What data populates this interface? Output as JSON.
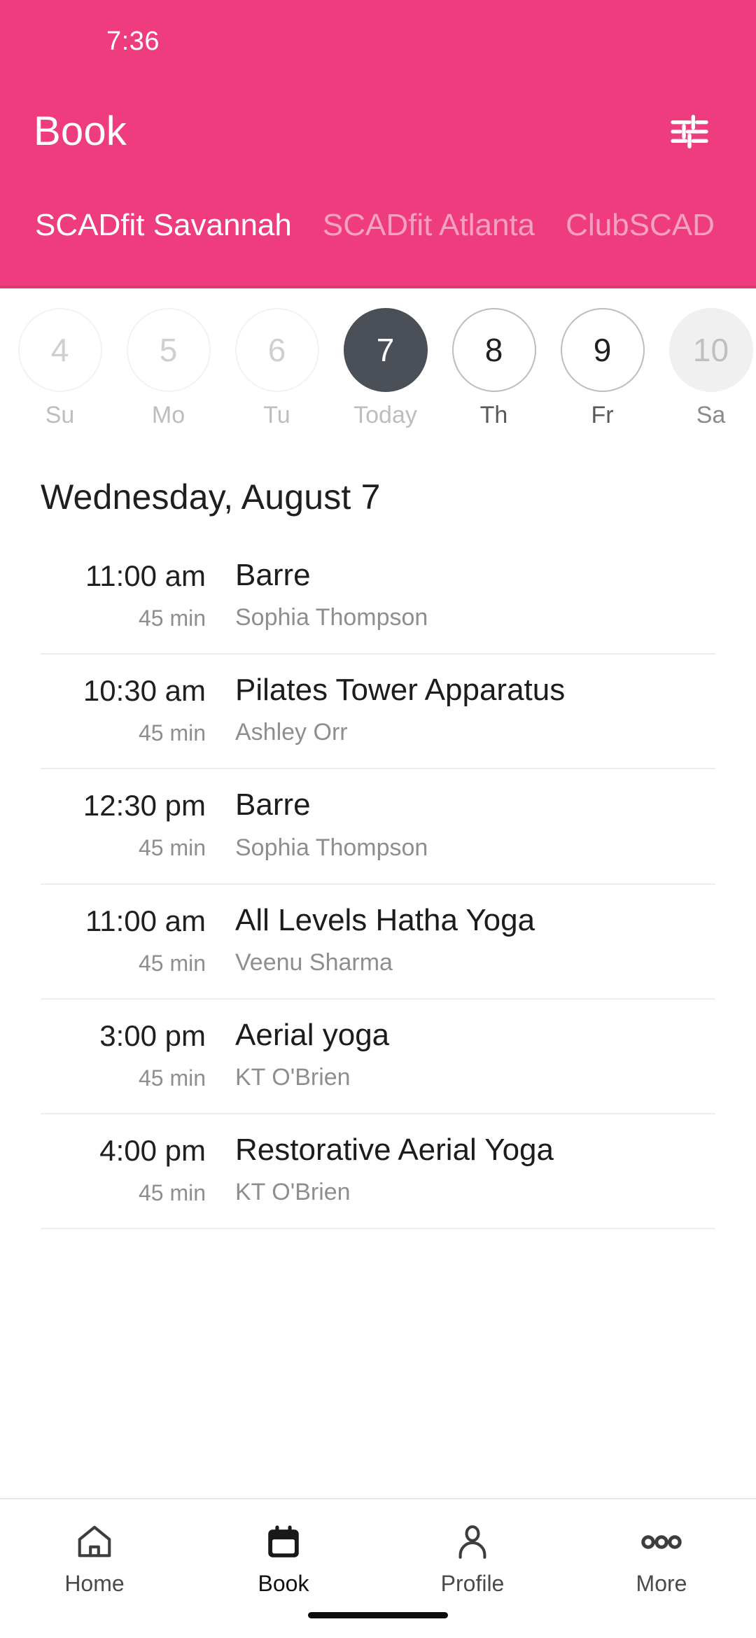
{
  "status_bar": {
    "time": "7:36"
  },
  "header": {
    "title": "Book",
    "accent_color": "#ee3c7e",
    "filter_icon": "tune-filter-icon",
    "tabs": [
      {
        "label": "SCADfit Savannah",
        "active": true
      },
      {
        "label": "SCADfit Atlanta",
        "active": false
      },
      {
        "label": "ClubSCAD",
        "active": false
      }
    ]
  },
  "date_strip": {
    "selected_color": "#4a4f58",
    "days": [
      {
        "num": "4",
        "label": "Su",
        "state": "past"
      },
      {
        "num": "5",
        "label": "Mo",
        "state": "past"
      },
      {
        "num": "6",
        "label": "Tu",
        "state": "past"
      },
      {
        "num": "7",
        "label": "Today",
        "state": "selected"
      },
      {
        "num": "8",
        "label": "Th",
        "state": "avail"
      },
      {
        "num": "9",
        "label": "Fr",
        "state": "avail"
      },
      {
        "num": "10",
        "label": "Sa",
        "state": "edge"
      }
    ]
  },
  "schedule": {
    "day_title": "Wednesday, August 7",
    "classes": [
      {
        "time": "11:00 am",
        "duration": "45 min",
        "name": "Barre",
        "instructor": "Sophia Thompson"
      },
      {
        "time": "10:30 am",
        "duration": "45 min",
        "name": "Pilates Tower Apparatus",
        "instructor": "Ashley Orr"
      },
      {
        "time": "12:30 pm",
        "duration": "45 min",
        "name": "Barre",
        "instructor": "Sophia Thompson"
      },
      {
        "time": "11:00 am",
        "duration": "45 min",
        "name": "All Levels Hatha Yoga",
        "instructor": "Veenu Sharma"
      },
      {
        "time": "3:00 pm",
        "duration": "45 min",
        "name": "Aerial yoga",
        "instructor": "KT O'Brien"
      },
      {
        "time": "4:00 pm",
        "duration": "45 min",
        "name": "Restorative Aerial Yoga",
        "instructor": "KT O'Brien"
      }
    ]
  },
  "bottom_nav": {
    "items": [
      {
        "label": "Home",
        "icon": "home-icon",
        "active": false
      },
      {
        "label": "Book",
        "icon": "calendar-icon",
        "active": true
      },
      {
        "label": "Profile",
        "icon": "person-icon",
        "active": false
      },
      {
        "label": "More",
        "icon": "more-dots-icon",
        "active": false
      }
    ]
  }
}
